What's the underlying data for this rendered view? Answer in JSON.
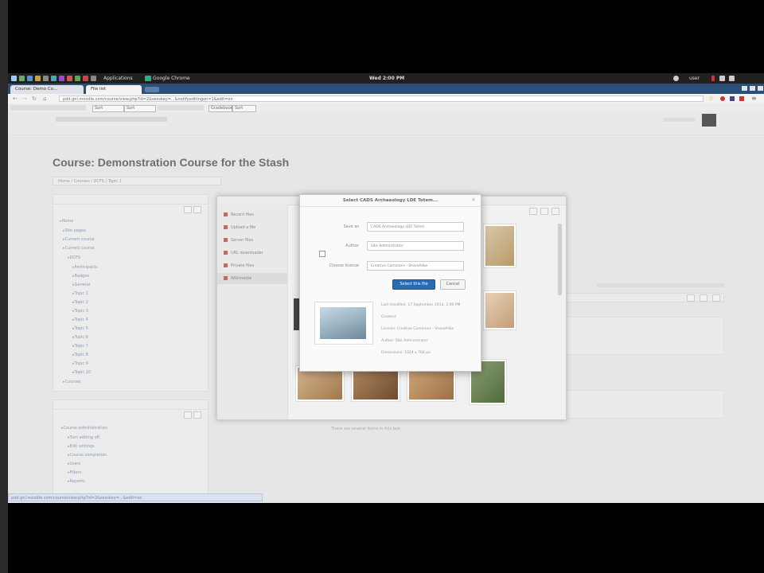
{
  "os_bar": {
    "applications_menu": "Applications",
    "active_app": "Google Chrome",
    "clock": "Wed 2:00 PM",
    "user": "user"
  },
  "browser": {
    "tabs": [
      {
        "label": "Course: Demo Co..."
      },
      {
        "label": "File list"
      }
    ],
    "url": "pdd.gnl.moodle.com/course/view.php?id=2&sesskey=...&notifyeditingon=1&edit=on",
    "bookmarks": [
      "Sort",
      "Sort",
      "Gradebook",
      "Sort"
    ]
  },
  "moodle": {
    "course_title": "Course: Demonstration Course for the Stash",
    "breadcrumb": "Home / Courses / DCFS / Topic 1"
  },
  "navigation_block": {
    "items": [
      "Home",
      "Site pages",
      "Current course",
      "DCFS",
      "Participants",
      "Badges",
      "General",
      "Topic 1",
      "Topic 2",
      "Topic 3",
      "Topic 4",
      "Topic 5",
      "Topic 6",
      "Topic 7",
      "Topic 8",
      "Topic 9",
      "Topic 10",
      "Courses"
    ]
  },
  "admin_block": {
    "items": [
      "Course administration",
      "Turn editing off",
      "Edit settings",
      "Course completion",
      "Users",
      "Filters",
      "Reports"
    ]
  },
  "filepicker": {
    "repositories": [
      "Recent files",
      "Upload a file",
      "Server files",
      "URL downloader",
      "Private files",
      "Wikimedia"
    ],
    "footer_note": "There are several items in this box"
  },
  "dialog": {
    "title": "Select CADS Archaeology LDE Totem...",
    "fields": [
      {
        "label": "Save as",
        "value": "CADS Archaeology LDE Totem"
      },
      {
        "label": "Author",
        "value": "Site Administrator"
      },
      {
        "label": "Choose license",
        "value": "Creative Commons - ShareAlike"
      }
    ],
    "select_button": "Select this file",
    "cancel_button": "Cancel",
    "file_info": [
      "Last modified: 17 September 2014, 2:00 PM",
      "Created:",
      "License: Creative Commons - ShareAlike",
      "Author: Site Administrator",
      "Dimensions: 1024 x 768 px"
    ]
  },
  "status_bar": "pdd.gnl.moodle.com/course/view.php?id=2&sesskey=...&edit=on",
  "colors": {
    "primary_button": "#2a6ab2",
    "tab_strip": "#2b4f78",
    "page_background": "#e6e6e6"
  }
}
